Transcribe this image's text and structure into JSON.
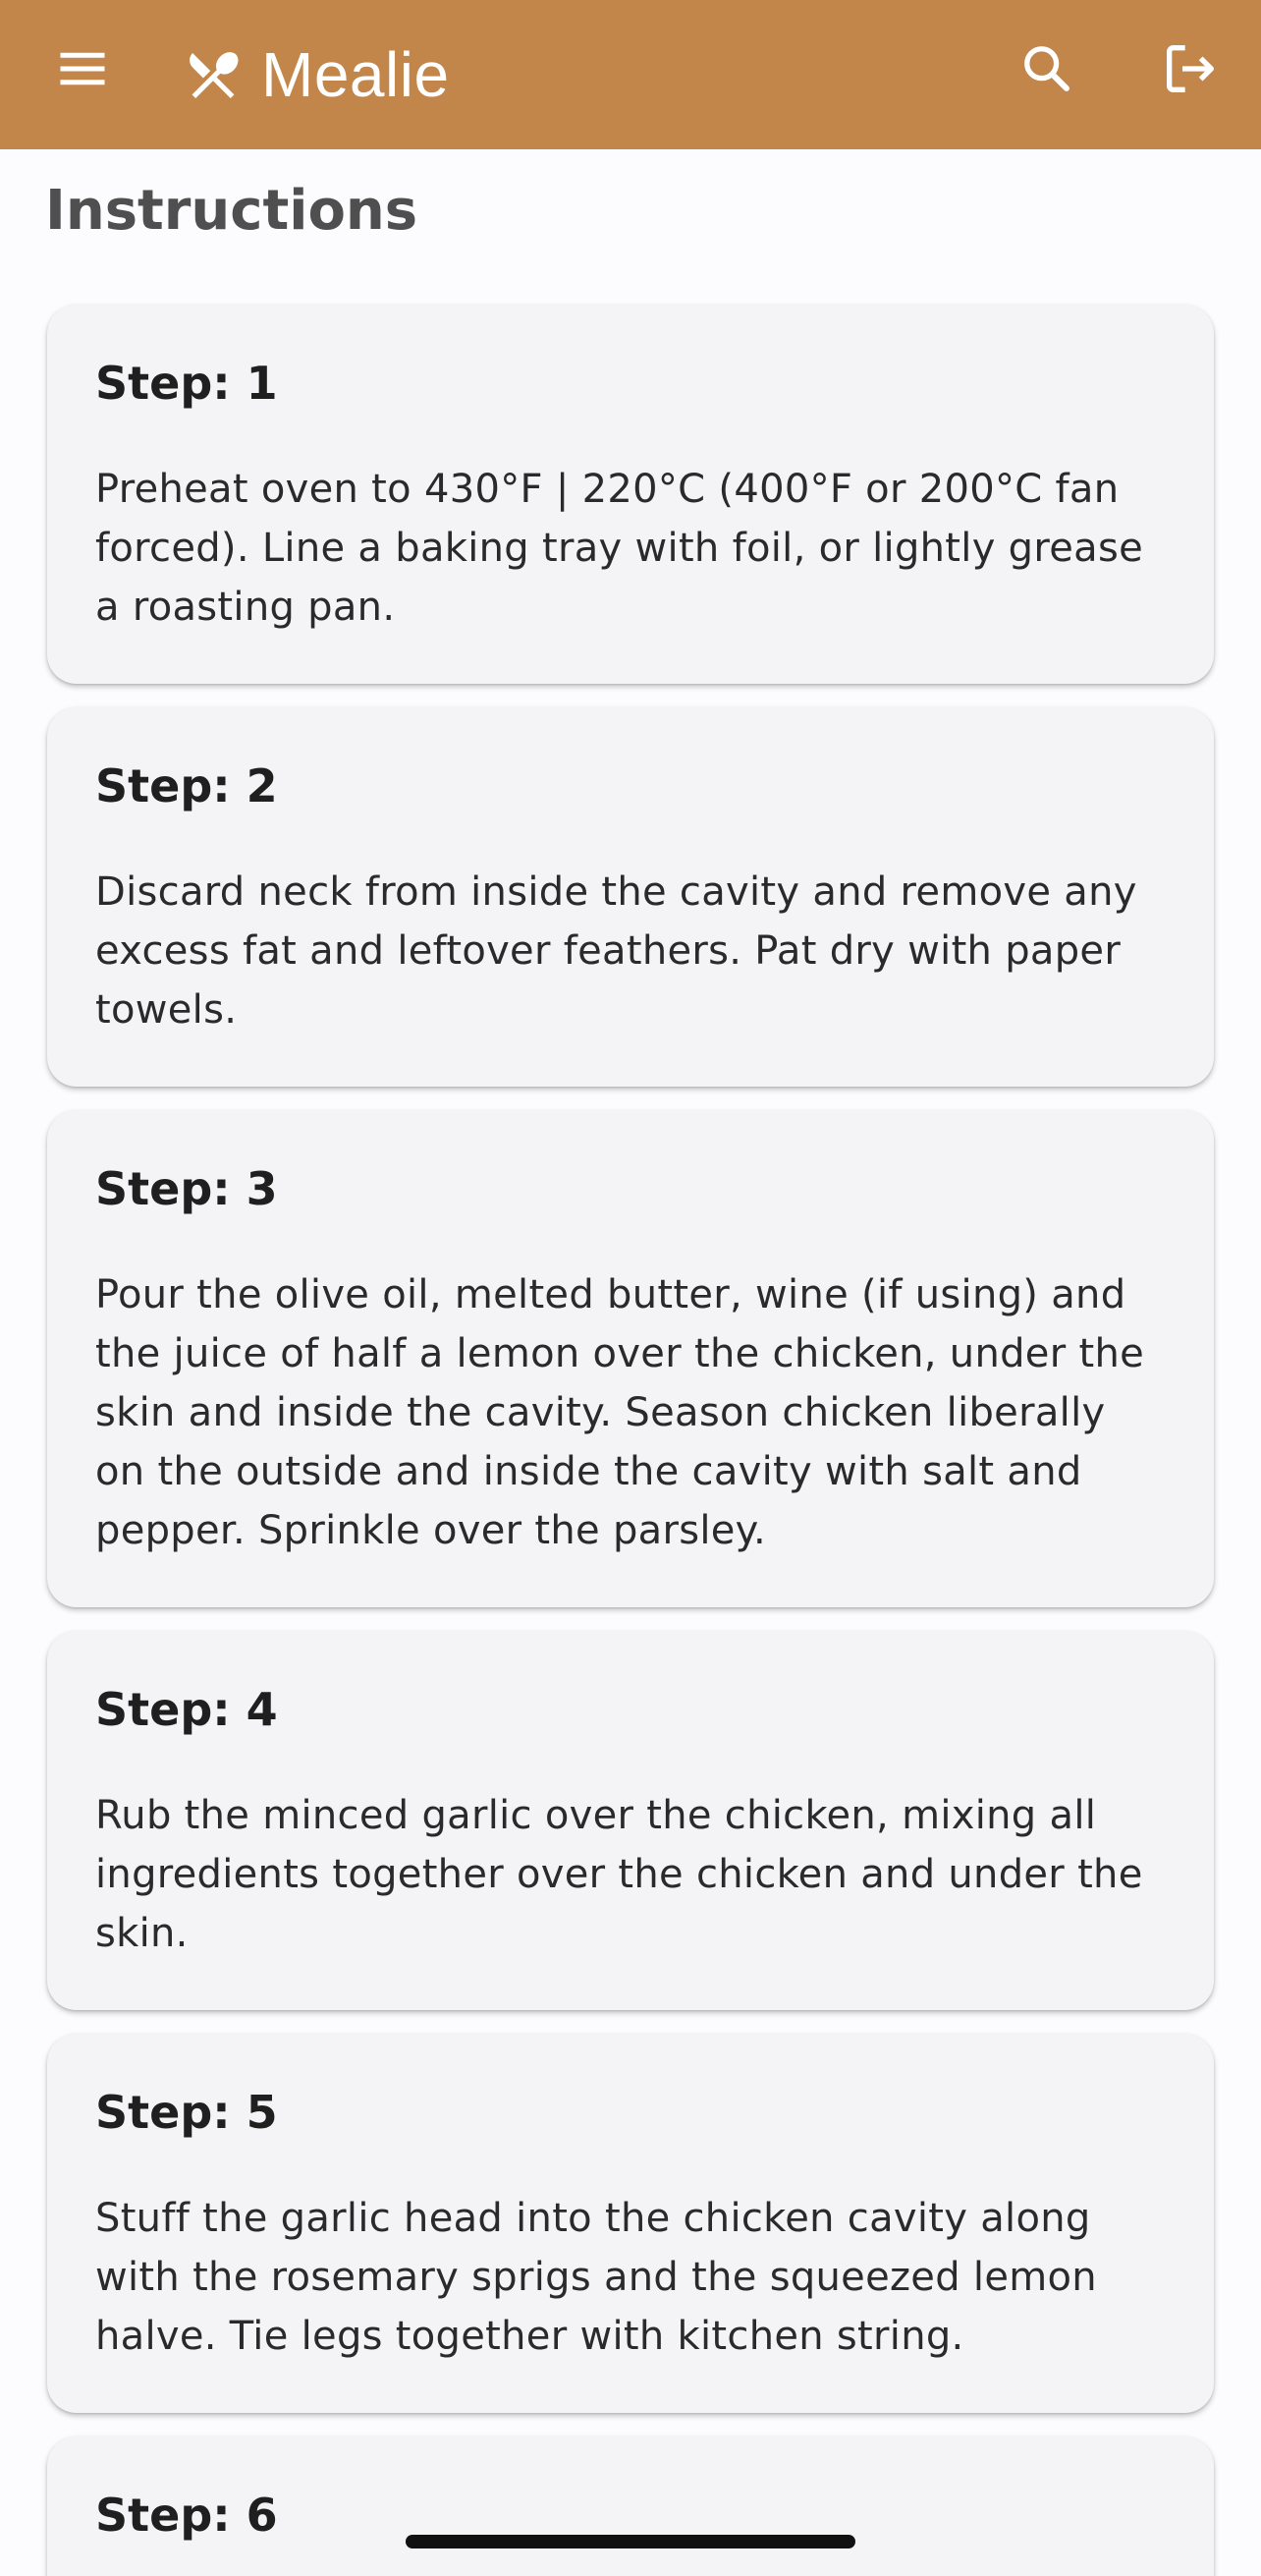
{
  "app_bar": {
    "title": "Mealie",
    "menu_icon": "hamburger-menu-icon",
    "logo_icon": "fork-knife-icon",
    "search_icon": "search-icon",
    "logout_icon": "logout-icon",
    "background_color": "#c2864b"
  },
  "instructions": {
    "heading": "Instructions",
    "steps": [
      {
        "label": "Step: 1",
        "text": "Preheat oven to 430°F | 220°C (400°F or 200°C fan forced). Line a baking tray with foil, or lightly grease a roasting pan."
      },
      {
        "label": "Step: 2",
        "text": "Discard neck from inside the cavity and remove any excess fat and leftover feathers. Pat dry with paper towels."
      },
      {
        "label": "Step: 3",
        "text": "Pour the olive oil, melted butter, wine (if using) and the juice of half a lemon over the chicken, under the skin and inside the cavity. Season chicken liberally on the outside and inside the cavity with salt and pepper. Sprinkle over the parsley."
      },
      {
        "label": "Step: 4",
        "text": "Rub the minced garlic over the chicken, mixing all ingredients together over the chicken and under the skin."
      },
      {
        "label": "Step: 5",
        "text": "Stuff the garlic head into the chicken cavity along with the rosemary sprigs and the squeezed lemon halve. Tie legs together with kitchen string."
      },
      {
        "label": "Step: 6",
        "text": ""
      }
    ]
  }
}
